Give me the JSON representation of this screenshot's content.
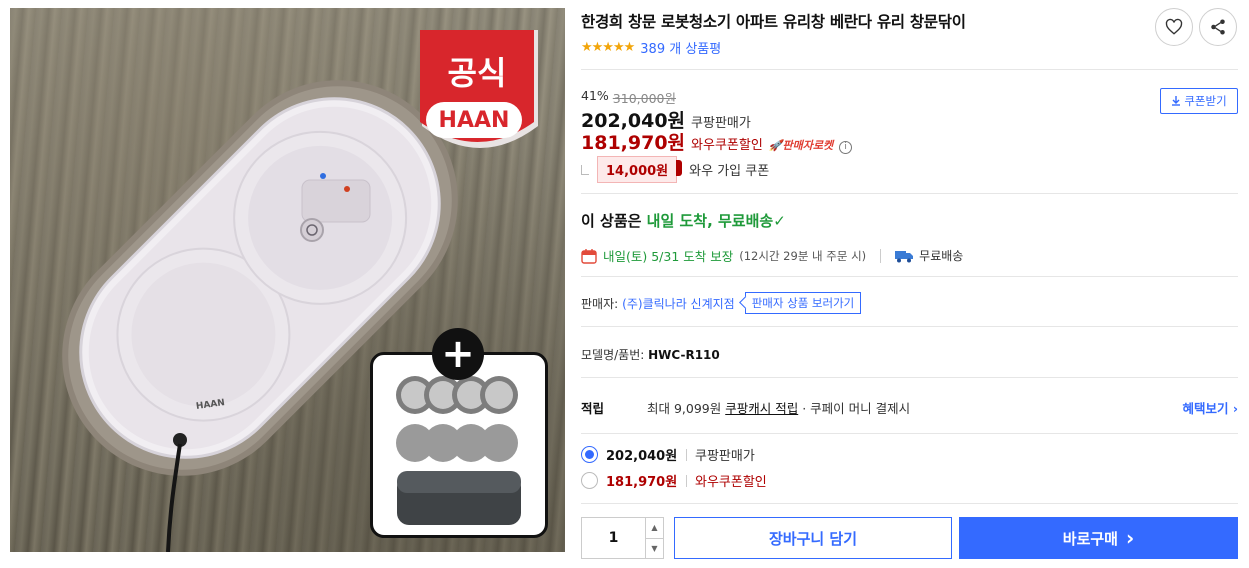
{
  "product": {
    "title": "한경희 창문 로봇청소기 아파트 유리창 베란다 유리 창문닦이",
    "rating_stars": "★★★★★",
    "rating_value": 5,
    "review_count": "389 개 상품평",
    "discount_rate": "41%",
    "original_price": "310,000원",
    "sale_price": "202,040원",
    "sale_label": "쿠팡판매가",
    "wow_price": "181,970원",
    "wow_label": "와우쿠폰할인",
    "rocket_label": "판매자로켓",
    "member_coupon_amount": "14,000원",
    "member_coupon_label": "와우 가입 쿠폰",
    "coupon_button": "쿠폰받기"
  },
  "image": {
    "badge_top": "공식",
    "badge_bottom": "HAAN",
    "robot_brand": "HAAN",
    "plus_symbol": "+"
  },
  "delivery": {
    "headline_prefix": "이 상품은 ",
    "headline_highlight": "내일 도착, 무료배송",
    "headline_check": "✓",
    "arrival": "내일(토) 5/31 도착 보장",
    "arrival_note": "(12시간 29분 내 주문 시)",
    "shipping": "무료배송"
  },
  "seller": {
    "label": "판매자:",
    "name": "(주)클릭나라 신계지점",
    "more_button": "판매자 상품 보러가기"
  },
  "model": {
    "label": "모델명/품번: ",
    "value": "HWC-R110"
  },
  "points": {
    "label": "적립",
    "max_text": "최대 9,099원 ",
    "cash_text": "쿠팡캐시 적립",
    "pay_text": " · 쿠페이 머니 결제시",
    "benefit_link": "혜택보기 ›"
  },
  "options": [
    {
      "price": "202,040원",
      "label": "쿠팡판매가",
      "selected": true
    },
    {
      "price": "181,970원",
      "label": "와우쿠폰할인",
      "selected": false
    }
  ],
  "purchase": {
    "quantity": "1",
    "cart_button": "장바구니 담기",
    "buy_button": "바로구매",
    "buy_arrow": "›"
  },
  "colors": {
    "accent_blue": "#346aff",
    "price_red": "#ae0000",
    "delivery_green": "#1f9a3a",
    "star_orange": "#f2a50a"
  }
}
